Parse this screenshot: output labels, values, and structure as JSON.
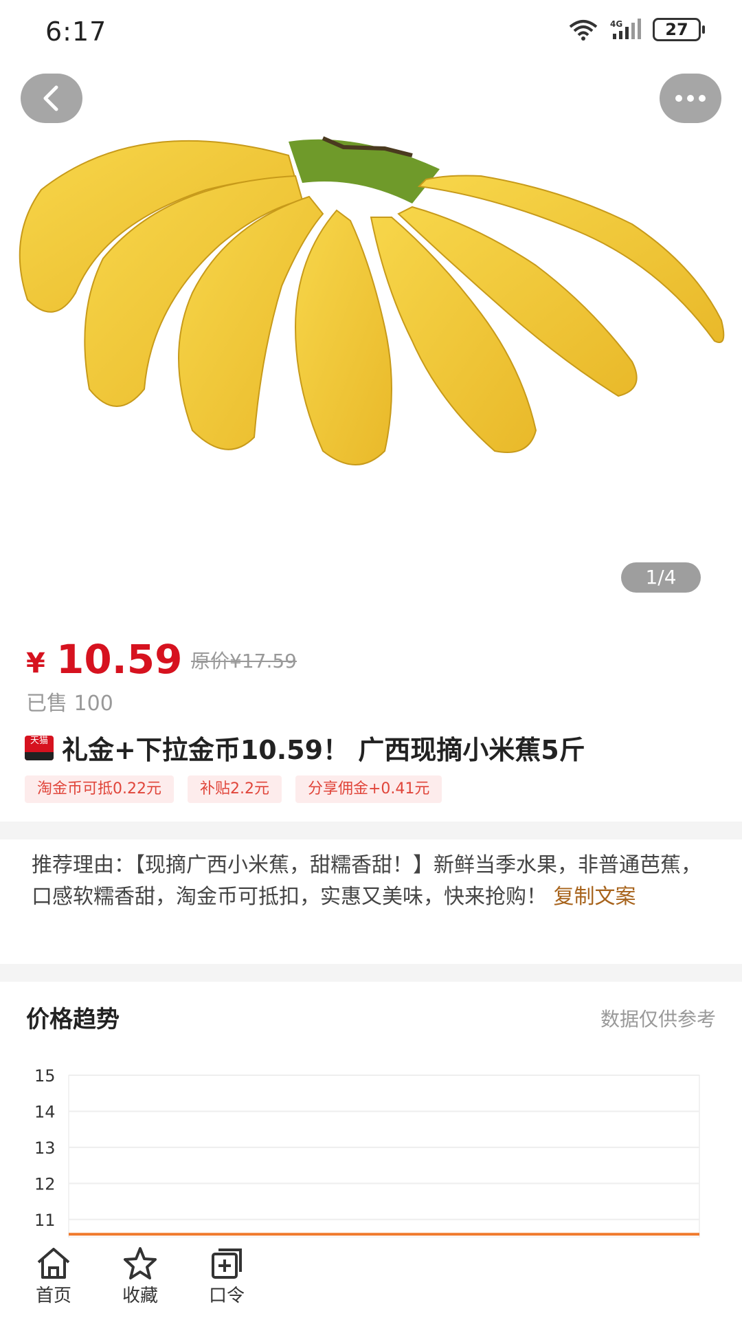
{
  "status_bar": {
    "time": "6:17",
    "battery": "27"
  },
  "product": {
    "image_icon": "banana-image",
    "page_indicator": "1/4",
    "currency": "¥",
    "price": "10.59",
    "original_price": "原价¥17.59",
    "sold": "已售 100",
    "shop_badge": "天猫",
    "title": "礼金+下拉金币10.59！ 广西现摘小米蕉5斤",
    "tags": [
      "淘金币可抵0.22元",
      "补贴2.2元",
      "分享佣金+0.41元"
    ]
  },
  "recommendation": {
    "text": "推荐理由：【现摘广西小米蕉，甜糯香甜！】新鲜当季水果，非普通芭蕉，口感软糯香甜，淘金币可抵扣，实惠又美味，快来抢购！",
    "copy_label": "复制文案"
  },
  "price_trend": {
    "title": "价格趋势",
    "note": "数据仅供参考"
  },
  "chart_data": {
    "type": "line",
    "y_ticks": [
      "15",
      "14",
      "13",
      "12",
      "11"
    ],
    "ylim": [
      10.5,
      15
    ],
    "series": [
      {
        "values": [
          10.59,
          10.59
        ],
        "color": "#f07a2c"
      }
    ]
  },
  "bottom_nav": [
    {
      "label": "首页",
      "icon": "home-icon"
    },
    {
      "label": "收藏",
      "icon": "star-icon"
    },
    {
      "label": "口令",
      "icon": "copy-add-icon"
    }
  ],
  "colors": {
    "price_red": "#d6121f",
    "tag_bg": "#fdecec",
    "link_brown": "#a7631c",
    "trend_orange": "#f07a2c"
  }
}
